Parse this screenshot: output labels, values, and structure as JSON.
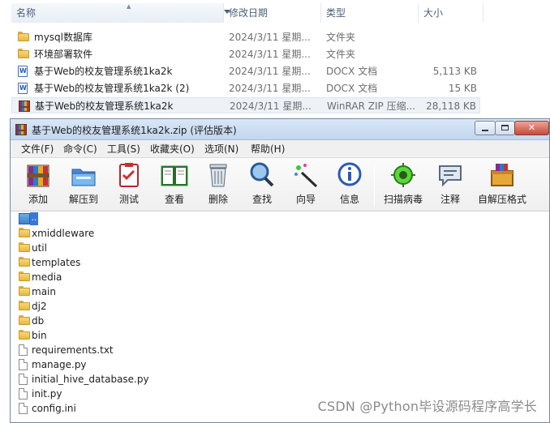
{
  "explorer": {
    "columns": {
      "name": "名称",
      "date": "修改日期",
      "type": "类型",
      "size": "大小"
    },
    "rows": [
      {
        "icon": "folder-icon",
        "name": "mysql数据库",
        "date": "2024/3/11 星期...",
        "type": "文件夹",
        "size": ""
      },
      {
        "icon": "folder-icon",
        "name": "环境部署软件",
        "date": "2024/3/11 星期...",
        "type": "文件夹",
        "size": ""
      },
      {
        "icon": "docx-icon",
        "name": "基于Web的校友管理系统1ka2k",
        "date": "2024/3/11 星期...",
        "type": "DOCX 文档",
        "size": "5,113 KB"
      },
      {
        "icon": "docx-icon",
        "name": "基于Web的校友管理系统1ka2k (2)",
        "date": "2024/3/11 星期...",
        "type": "DOCX 文档",
        "size": "15 KB"
      },
      {
        "icon": "winrar-archive-icon",
        "name": "基于Web的校友管理系统1ka2k",
        "date": "2024/3/11 星期...",
        "type": "WinRAR ZIP 压缩...",
        "size": "28,118 KB"
      }
    ]
  },
  "winrar": {
    "title": "基于Web的校友管理系统1ka2k.zip (评估版本)",
    "menu": [
      "文件(F)",
      "命令(C)",
      "工具(S)",
      "收藏夹(O)",
      "选项(N)",
      "帮助(H)"
    ],
    "toolbar": [
      {
        "icon": "add-archive-icon",
        "label": "添加"
      },
      {
        "icon": "extract-to-icon",
        "label": "解压到"
      },
      {
        "icon": "test-icon",
        "label": "测试"
      },
      {
        "icon": "view-book-icon",
        "label": "查看"
      },
      {
        "icon": "trash-icon",
        "label": "删除"
      },
      {
        "icon": "find-magnifier-icon",
        "label": "查找"
      },
      {
        "icon": "wizard-wand-icon",
        "label": "向导"
      },
      {
        "icon": "info-icon",
        "label": "信息"
      },
      {
        "icon": "virus-scan-icon",
        "label": "扫描病毒"
      },
      {
        "icon": "comment-icon",
        "label": "注释"
      },
      {
        "icon": "sfx-icon",
        "label": "自解压格式"
      }
    ],
    "files": [
      {
        "icon": "parent-folder-icon",
        "name": ".."
      },
      {
        "icon": "folder-icon",
        "name": "xmiddleware"
      },
      {
        "icon": "folder-icon",
        "name": "util"
      },
      {
        "icon": "folder-icon",
        "name": "templates"
      },
      {
        "icon": "folder-icon",
        "name": "media"
      },
      {
        "icon": "folder-icon",
        "name": "main"
      },
      {
        "icon": "folder-icon",
        "name": "dj2"
      },
      {
        "icon": "folder-icon",
        "name": "db"
      },
      {
        "icon": "folder-icon",
        "name": "bin"
      },
      {
        "icon": "file-icon",
        "name": "requirements.txt"
      },
      {
        "icon": "file-icon",
        "name": "manage.py"
      },
      {
        "icon": "file-icon",
        "name": "initial_hive_database.py"
      },
      {
        "icon": "file-icon",
        "name": "init.py"
      },
      {
        "icon": "file-icon",
        "name": "config.ini"
      }
    ]
  },
  "watermark": "CSDN @Python毕设源码程序高学长"
}
